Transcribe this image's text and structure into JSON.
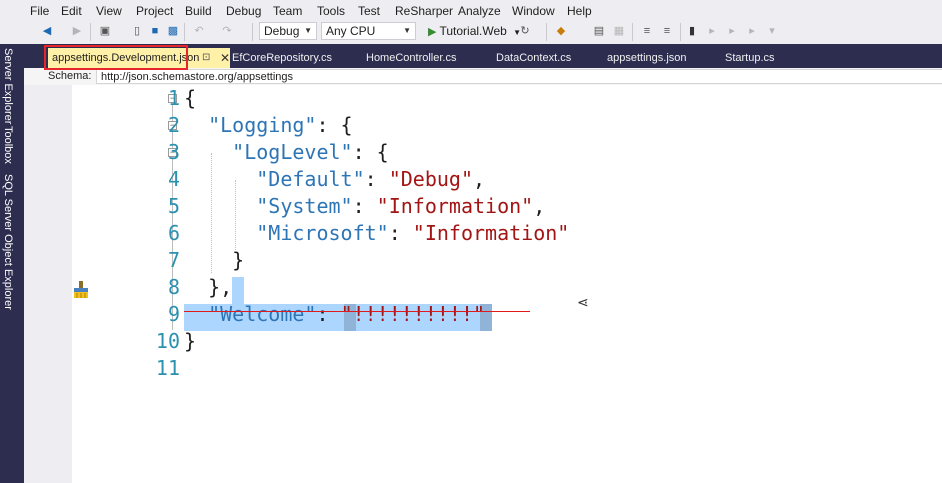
{
  "menu": [
    "File",
    "Edit",
    "View",
    "Project",
    "Build",
    "Debug",
    "Team",
    "Tools",
    "Test",
    "ReSharper",
    "Analyze",
    "Window",
    "Help"
  ],
  "toolbar": {
    "config": "Debug",
    "platform": "Any CPU",
    "run_target": "Tutorial.Web"
  },
  "side_tabs": [
    "Server Explorer",
    "Toolbox",
    "SQL Server Object Explorer"
  ],
  "tabs": [
    {
      "label": "appsettings.Development.json",
      "active": true
    },
    {
      "label": "EfCoreRepository.cs"
    },
    {
      "label": "HomeController.cs"
    },
    {
      "label": "DataContext.cs"
    },
    {
      "label": "appsettings.json"
    },
    {
      "label": "Startup.cs"
    }
  ],
  "schema": {
    "label": "Schema:",
    "value": "http://json.schemastore.org/appsettings"
  },
  "editor": {
    "line_numbers": [
      "1",
      "2",
      "3",
      "4",
      "5",
      "6",
      "7",
      "8",
      "9",
      "10",
      "11"
    ],
    "lines": [
      [
        {
          "t": "{",
          "c": "p"
        }
      ],
      [
        {
          "t": "  ",
          "c": "p"
        },
        {
          "t": "\"Logging\"",
          "c": "k"
        },
        {
          "t": ": {",
          "c": "p"
        }
      ],
      [
        {
          "t": "    ",
          "c": "p"
        },
        {
          "t": "\"LogLevel\"",
          "c": "k"
        },
        {
          "t": ": {",
          "c": "p"
        }
      ],
      [
        {
          "t": "      ",
          "c": "p"
        },
        {
          "t": "\"Default\"",
          "c": "k"
        },
        {
          "t": ": ",
          "c": "p"
        },
        {
          "t": "\"Debug\"",
          "c": "s"
        },
        {
          "t": ",",
          "c": "p"
        }
      ],
      [
        {
          "t": "      ",
          "c": "p"
        },
        {
          "t": "\"System\"",
          "c": "k"
        },
        {
          "t": ": ",
          "c": "p"
        },
        {
          "t": "\"Information\"",
          "c": "s"
        },
        {
          "t": ",",
          "c": "p"
        }
      ],
      [
        {
          "t": "      ",
          "c": "p"
        },
        {
          "t": "\"Microsoft\"",
          "c": "k"
        },
        {
          "t": ": ",
          "c": "p"
        },
        {
          "t": "\"Information\"",
          "c": "s"
        }
      ],
      [
        {
          "t": "    }",
          "c": "p"
        }
      ],
      [
        {
          "t": "  },",
          "c": "p"
        }
      ],
      [
        {
          "t": "  ",
          "c": "p"
        },
        {
          "t": "\"Welcome\"",
          "c": "k"
        },
        {
          "t": ": ",
          "c": "p"
        },
        {
          "t": "\"!!!!!!!!!!\"",
          "c": "s"
        }
      ],
      [
        {
          "t": "}",
          "c": "p"
        }
      ],
      [
        {
          "t": "",
          "c": "p"
        }
      ]
    ]
  },
  "colors": {
    "key": "#2e75b6",
    "string": "#a31515",
    "line_number": "#2b91af",
    "selection": "#add6ff",
    "highlight_box": "#e8252b",
    "tab_active": "#fff1a8",
    "chrome_dark": "#2d2d50"
  }
}
